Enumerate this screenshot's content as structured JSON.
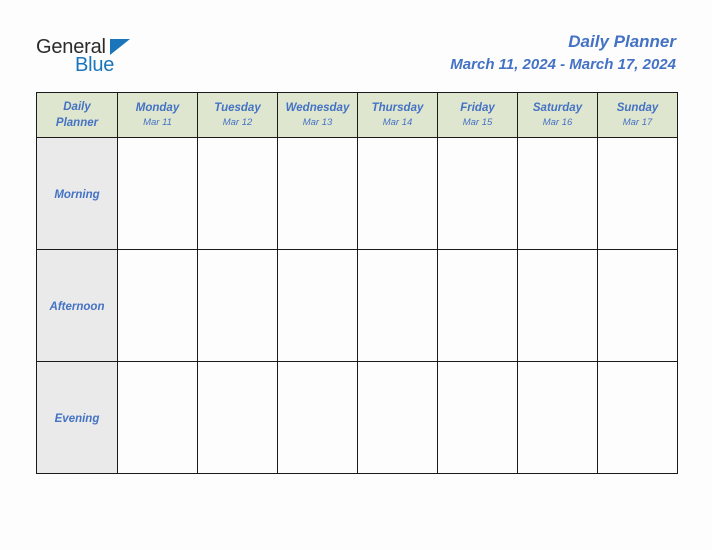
{
  "brand": {
    "name_part1": "General",
    "name_part2": "Blue",
    "logo_icon": "blue-triangle-icon",
    "color_dark": "#2b2b2b",
    "color_blue": "#1b75bb"
  },
  "header": {
    "title": "Daily Planner",
    "date_range": "March 11, 2024 - March 17, 2024",
    "title_color": "#4472c4"
  },
  "table": {
    "corner_label_line1": "Daily",
    "corner_label_line2": "Planner",
    "header_bg": "#dfe6cf",
    "row_label_bg": "#eaeaea",
    "cell_bg": "#fdfdfd",
    "border_color": "#1a1a1a",
    "columns": [
      {
        "day": "Monday",
        "date": "Mar 11"
      },
      {
        "day": "Tuesday",
        "date": "Mar 12"
      },
      {
        "day": "Wednesday",
        "date": "Mar 13"
      },
      {
        "day": "Thursday",
        "date": "Mar 14"
      },
      {
        "day": "Friday",
        "date": "Mar 15"
      },
      {
        "day": "Saturday",
        "date": "Mar 16"
      },
      {
        "day": "Sunday",
        "date": "Mar 17"
      }
    ],
    "rows": [
      {
        "label": "Morning",
        "entries": [
          "",
          "",
          "",
          "",
          "",
          "",
          ""
        ]
      },
      {
        "label": "Afternoon",
        "entries": [
          "",
          "",
          "",
          "",
          "",
          "",
          ""
        ]
      },
      {
        "label": "Evening",
        "entries": [
          "",
          "",
          "",
          "",
          "",
          "",
          ""
        ]
      }
    ]
  }
}
